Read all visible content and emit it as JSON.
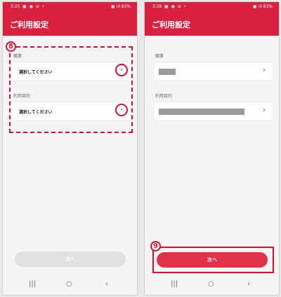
{
  "left": {
    "status": {
      "time": "3:25",
      "icons": "▣ ◉ ⊖ •",
      "right": "▣ ⁞ıl 82%"
    },
    "title": "ご利用設定",
    "badge": "8",
    "occupation_label": "職業",
    "occupation_value": "選択してください",
    "purpose_label": "利用目的",
    "purpose_value": "選択してください",
    "next_label": "次へ"
  },
  "right": {
    "status": {
      "time": "3:26",
      "icons": "▣ ◉ ⊖ •",
      "right": "▣ ⁞ıl 83%"
    },
    "title": "ご利用設定",
    "badge": "9",
    "occupation_label": "職業",
    "purpose_label": "利用目的",
    "next_label": "次へ"
  },
  "nav": {
    "recents": "|||",
    "home": "○",
    "back": "‹"
  },
  "chevron": "›",
  "colors": {
    "brand": "#d9213f",
    "annotation": "#e00d2b"
  }
}
